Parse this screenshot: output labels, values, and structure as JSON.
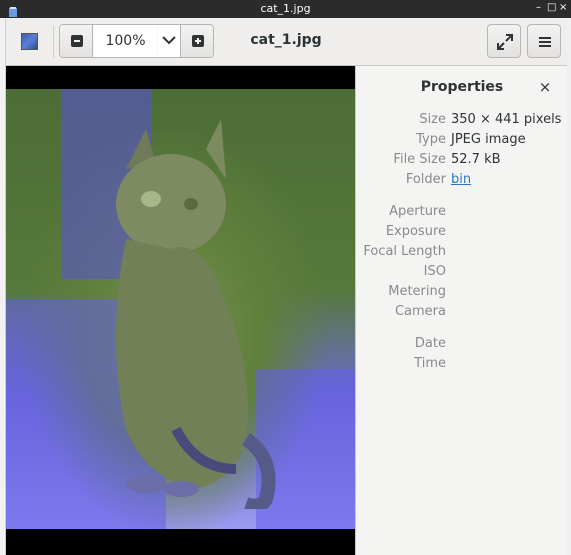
{
  "window": {
    "title": "cat_1.jpg"
  },
  "header": {
    "zoom": "100%",
    "doc_title": "cat_1.jpg"
  },
  "properties": {
    "title": "Properties",
    "rows": [
      {
        "label": "Size",
        "value": "350 × 441 pixels"
      },
      {
        "label": "Type",
        "value": "JPEG image"
      },
      {
        "label": "File Size",
        "value": "52.7 kB"
      },
      {
        "label": "Folder",
        "value": "bin"
      }
    ],
    "exif": [
      {
        "label": "Aperture",
        "value": ""
      },
      {
        "label": "Exposure",
        "value": ""
      },
      {
        "label": "Focal Length",
        "value": ""
      },
      {
        "label": "ISO",
        "value": ""
      },
      {
        "label": "Metering",
        "value": ""
      },
      {
        "label": "Camera",
        "value": ""
      }
    ],
    "datetime": [
      {
        "label": "Date",
        "value": ""
      },
      {
        "label": "Time",
        "value": ""
      }
    ]
  },
  "icons": [
    "app-icon",
    "image-thumbnail-icon",
    "zoom-out-icon",
    "chevron-down-icon",
    "zoom-in-icon",
    "fullscreen-icon",
    "hamburger-menu-icon",
    "close-icon"
  ]
}
